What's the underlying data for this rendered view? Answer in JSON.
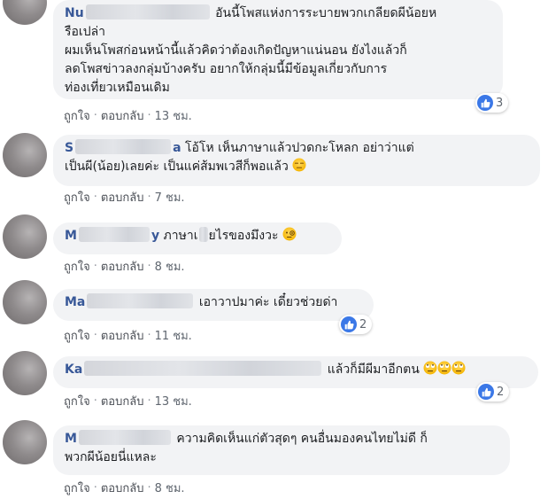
{
  "comments": [
    {
      "author_visible": "Nu",
      "text": "อันนี้โพสแห่งการระบายพวกเกลียดผีน้อยหรือเปล่า ผมเห็นโพสก่อนหน้านี้แล้วคิดว่าต้องเกิดปัญหาแน่นอน ยังไงแล้วก็ลดโพสข่าวลงกลุ่มบ้างครับ อยากให้กลุ่มนี้มีข้อมูลเกี่ยวกับการท่องเที่ยวเหมือนเดิม",
      "text_lines": [
        "อันนี้โพสแห่งการระบายพวกเกลียดผีน้อยห",
        "รือเปล่า",
        "ผมเห็นโพสก่อนหน้านี้แล้วคิดว่าต้องเกิดปัญหาแน่นอน ยังไงแล้วก็",
        "ลดโพสข่าวลงกลุ่มบ้างครับ อยากให้กลุ่มนี้มีข้อมูลเกี่ยวกับการ",
        "ท่องเที่ยวเหมือนเดิม"
      ],
      "like_label": "ถูกใจ",
      "reply_label": "ตอบกลับ",
      "time": "13 ชม.",
      "reaction_count": "3"
    },
    {
      "author_visible": "S",
      "author_tail": "a",
      "text_lines": [
        "โอ้โห เห็นภาษาแล้วปวดกะโหลก อย่าว่าแต่",
        "เป็นผี(น้อย)เลยค่ะ เป็นแค่ส้มพเวสีก็พอแล้ว"
      ],
      "like_label": "ถูกใจ",
      "reply_label": "ตอบกลับ",
      "time": "7 ชม."
    },
    {
      "author_visible": "M",
      "author_tail": "y",
      "text_before": "ภาษาเ",
      "text_after": "ยไรของมึงวะ",
      "like_label": "ถูกใจ",
      "reply_label": "ตอบกลับ",
      "time": "8 ชม."
    },
    {
      "author_visible": "Ma",
      "text": "เอาวาปมาค่ะ เดี๋ยวช่วยด่า",
      "like_label": "ถูกใจ",
      "reply_label": "ตอบกลับ",
      "time": "11 ชม.",
      "reaction_count": "2"
    },
    {
      "author_visible": "Ka",
      "text": "แล้วก็มีผีมาอีกตน",
      "like_label": "ถูกใจ",
      "reply_label": "ตอบกลับ",
      "time": "13 ชม.",
      "reaction_count": "2"
    },
    {
      "author_visible": "M",
      "text_lines": [
        "ความคิดเห็นแก่ตัวสุดๆ คนอื่นมองคนไทยไม่ดี ก็",
        "พวกผีน้อยนี่แหละ"
      ],
      "like_label": "ถูกใจ",
      "reply_label": "ตอบกลับ",
      "time": "8 ชม."
    }
  ],
  "colors": {
    "author": "#385898",
    "bubble": "#f2f3f5",
    "like_blue": "#3b78e7",
    "meta_text": "#606770"
  },
  "icons": [
    "like-icon",
    "unamused-emoji",
    "face-with-monocle-emoji",
    "rolling-eyes-emoji"
  ]
}
